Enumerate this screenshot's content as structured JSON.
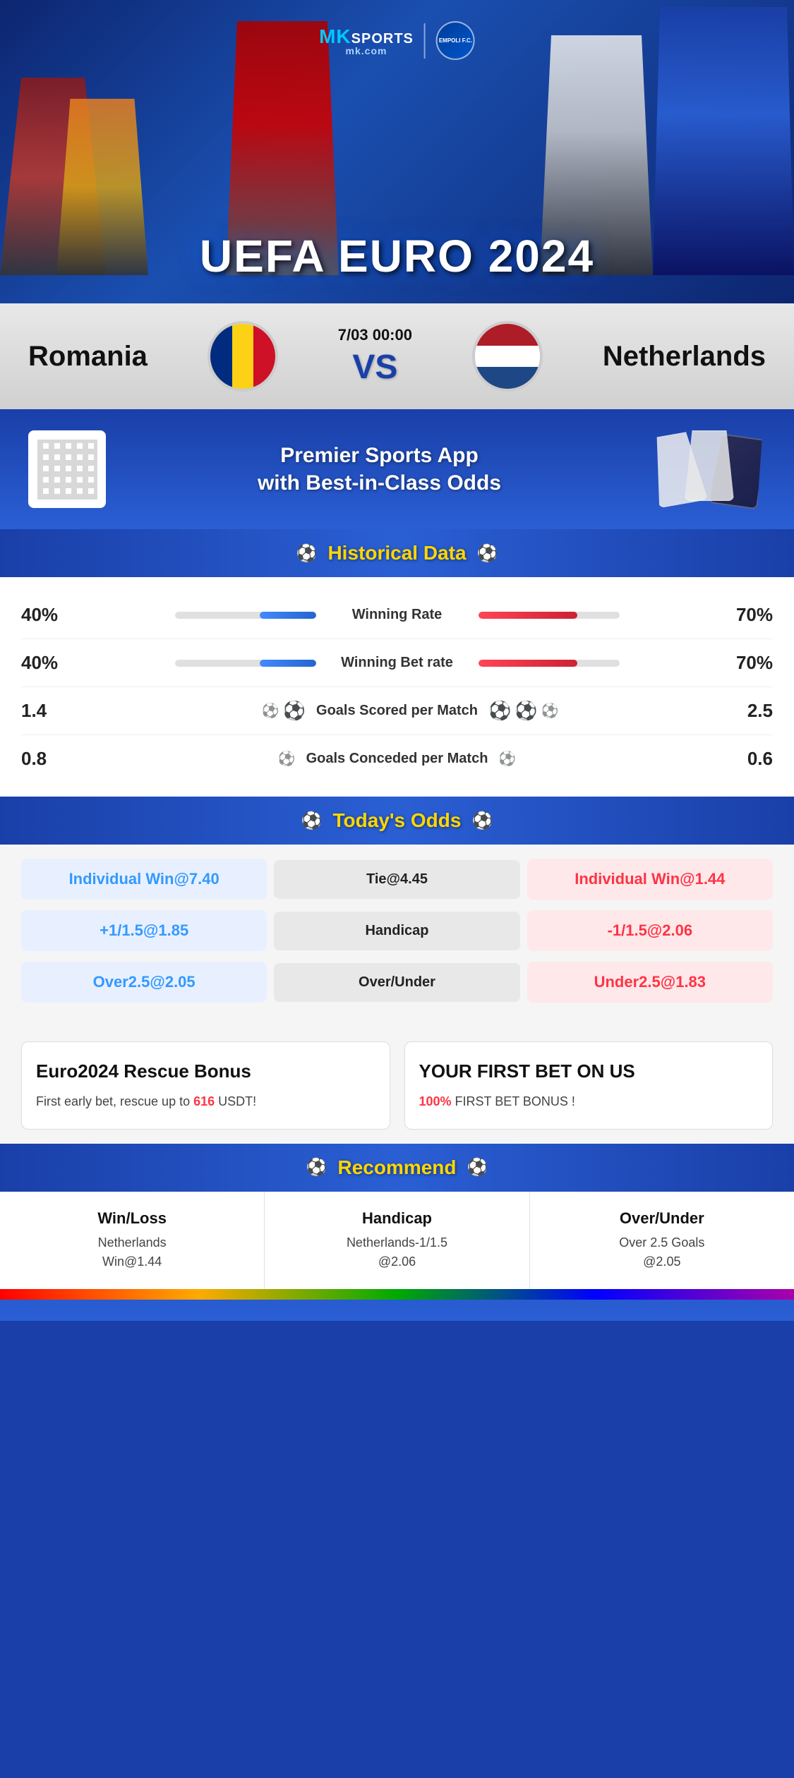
{
  "brand": {
    "name_mk": "MK",
    "name_sports": "SPORTS",
    "domain": "mk.com",
    "partner_badge": "EMPOLI F.C."
  },
  "hero": {
    "event": "UEFA EURO 2024"
  },
  "match": {
    "team_left": "Romania",
    "team_right": "Netherlands",
    "date_time": "7/03 00:00",
    "vs": "VS"
  },
  "promo": {
    "headline_line1": "Premier Sports App",
    "headline_line2": "with Best-in-Class Odds"
  },
  "historical": {
    "section_title": "Historical Data",
    "stats": [
      {
        "label": "Winning Rate",
        "left_val": "40%",
        "right_val": "70%",
        "left_pct": 40,
        "right_pct": 70,
        "type": "bar"
      },
      {
        "label": "Winning Bet rate",
        "left_val": "40%",
        "right_val": "70%",
        "left_pct": 40,
        "right_pct": 70,
        "type": "bar"
      },
      {
        "label": "Goals Scored per Match",
        "left_val": "1.4",
        "right_val": "2.5",
        "type": "goals"
      },
      {
        "label": "Goals Conceded per Match",
        "left_val": "0.8",
        "right_val": "0.6",
        "type": "goals_conceded"
      }
    ]
  },
  "odds": {
    "section_title": "Today's Odds",
    "rows": [
      {
        "left": "Individual Win@7.40",
        "center": "Tie@4.45",
        "right": "Individual Win@1.44"
      },
      {
        "left": "+1/1.5@1.85",
        "center": "Handicap",
        "right": "-1/1.5@2.06"
      },
      {
        "left": "Over2.5@2.05",
        "center": "Over/Under",
        "right": "Under2.5@1.83"
      }
    ]
  },
  "bonuses": [
    {
      "title": "Euro2024 Rescue Bonus",
      "body_before": "First early bet, rescue up to ",
      "highlight": "616",
      "body_after": " USDT!",
      "highlight_color": "#ff3344"
    },
    {
      "title": "YOUR FIRST BET ON US",
      "body_before": "",
      "highlight": "100%",
      "body_after": " FIRST BET BONUS !",
      "highlight_color": "#ff3344"
    }
  ],
  "recommend": {
    "section_title": "Recommend",
    "cols": [
      {
        "header": "Win/Loss",
        "line1": "Netherlands",
        "line2": "Win@1.44"
      },
      {
        "header": "Handicap",
        "line1": "Netherlands-1/1.5",
        "line2": "@2.06"
      },
      {
        "header": "Over/Under",
        "line1": "Over 2.5 Goals",
        "line2": "@2.05"
      }
    ]
  }
}
